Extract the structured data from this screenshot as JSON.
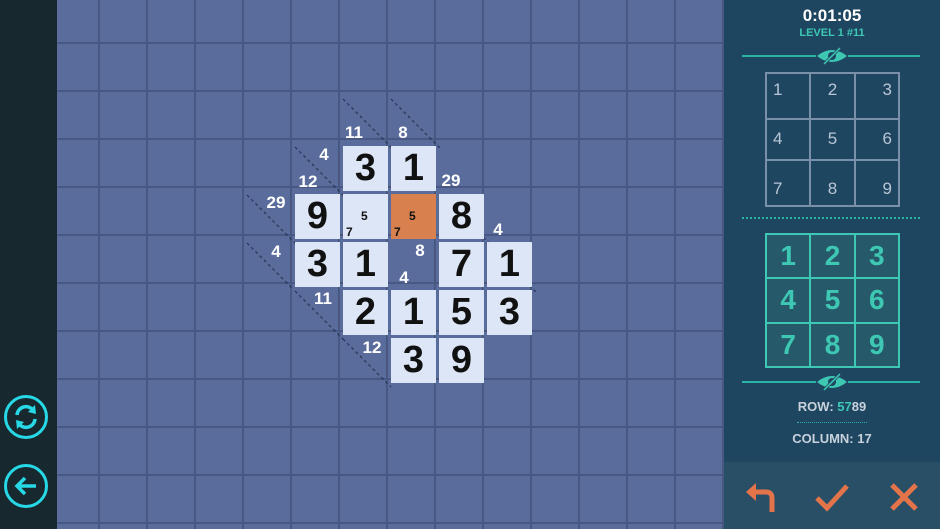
{
  "game": {
    "timer": "0:01:05",
    "level": "LEVEL 1 #11"
  },
  "colors": {
    "board": "#5a6c9c",
    "cell": "#dce6f7",
    "selected_cell": "#d8804e",
    "accent": "#3ec8b4",
    "panel": "#1f4660",
    "action_orange": "#e3744a"
  },
  "icons": {
    "left_top": "refresh-icon",
    "left_bottom": "back-arrow-icon",
    "eye_top": "eye-slash-icon",
    "eye_bottom": "eye-slash-icon",
    "undo": "undo-arrow-icon",
    "check": "check-icon",
    "cancel": "cross-icon"
  },
  "cells": [
    {
      "id": "r1c2",
      "value": "3"
    },
    {
      "id": "r1c3",
      "value": "1"
    },
    {
      "id": "r2c1",
      "value": "9"
    },
    {
      "id": "r2c2",
      "value": "",
      "notes": [
        "5",
        "7"
      ]
    },
    {
      "id": "r2c3",
      "value": "",
      "notes": [
        "5",
        "7"
      ],
      "selected": true
    },
    {
      "id": "r2c4",
      "value": "8"
    },
    {
      "id": "r3c1",
      "value": "3"
    },
    {
      "id": "r3c2",
      "value": "1"
    },
    {
      "id": "r3c4",
      "value": "7"
    },
    {
      "id": "r3c5",
      "value": "1"
    },
    {
      "id": "r4c2",
      "value": "2"
    },
    {
      "id": "r4c3",
      "value": "1"
    },
    {
      "id": "r4c4",
      "value": "5"
    },
    {
      "id": "r4c5",
      "value": "3"
    },
    {
      "id": "r5c3",
      "value": "3"
    },
    {
      "id": "r5c4",
      "value": "9"
    }
  ],
  "clues": [
    "11",
    "8",
    "4",
    "12",
    "29",
    "29",
    "4",
    "4",
    "8",
    "4",
    "11",
    "12"
  ],
  "notes_keypad": [
    "1",
    "2",
    "3",
    "4",
    "5",
    "6",
    "7",
    "8",
    "9"
  ],
  "number_keypad": [
    "1",
    "2",
    "3",
    "4",
    "5",
    "6",
    "7",
    "8",
    "9"
  ],
  "status": {
    "row_label": "ROW: ",
    "row_highlight": "57",
    "row_rest": "89",
    "column_label": "COLUMN: 17"
  }
}
